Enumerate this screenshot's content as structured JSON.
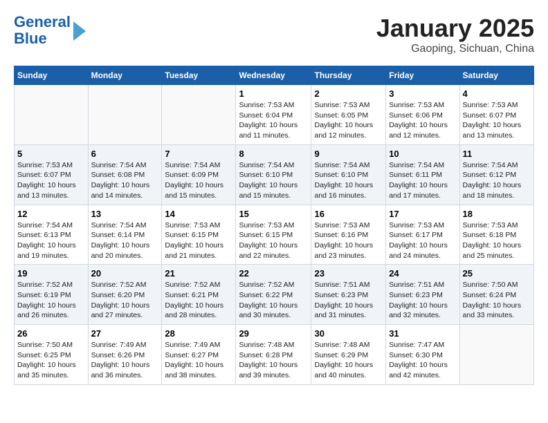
{
  "header": {
    "logo_line1": "General",
    "logo_line2": "Blue",
    "month": "January 2025",
    "location": "Gaoping, Sichuan, China"
  },
  "days_of_week": [
    "Sunday",
    "Monday",
    "Tuesday",
    "Wednesday",
    "Thursday",
    "Friday",
    "Saturday"
  ],
  "weeks": [
    [
      {
        "day": "",
        "content": ""
      },
      {
        "day": "",
        "content": ""
      },
      {
        "day": "",
        "content": ""
      },
      {
        "day": "1",
        "content": "Sunrise: 7:53 AM\nSunset: 6:04 PM\nDaylight: 10 hours and 11 minutes."
      },
      {
        "day": "2",
        "content": "Sunrise: 7:53 AM\nSunset: 6:05 PM\nDaylight: 10 hours and 12 minutes."
      },
      {
        "day": "3",
        "content": "Sunrise: 7:53 AM\nSunset: 6:06 PM\nDaylight: 10 hours and 12 minutes."
      },
      {
        "day": "4",
        "content": "Sunrise: 7:53 AM\nSunset: 6:07 PM\nDaylight: 10 hours and 13 minutes."
      }
    ],
    [
      {
        "day": "5",
        "content": "Sunrise: 7:53 AM\nSunset: 6:07 PM\nDaylight: 10 hours and 13 minutes."
      },
      {
        "day": "6",
        "content": "Sunrise: 7:54 AM\nSunset: 6:08 PM\nDaylight: 10 hours and 14 minutes."
      },
      {
        "day": "7",
        "content": "Sunrise: 7:54 AM\nSunset: 6:09 PM\nDaylight: 10 hours and 15 minutes."
      },
      {
        "day": "8",
        "content": "Sunrise: 7:54 AM\nSunset: 6:10 PM\nDaylight: 10 hours and 15 minutes."
      },
      {
        "day": "9",
        "content": "Sunrise: 7:54 AM\nSunset: 6:10 PM\nDaylight: 10 hours and 16 minutes."
      },
      {
        "day": "10",
        "content": "Sunrise: 7:54 AM\nSunset: 6:11 PM\nDaylight: 10 hours and 17 minutes."
      },
      {
        "day": "11",
        "content": "Sunrise: 7:54 AM\nSunset: 6:12 PM\nDaylight: 10 hours and 18 minutes."
      }
    ],
    [
      {
        "day": "12",
        "content": "Sunrise: 7:54 AM\nSunset: 6:13 PM\nDaylight: 10 hours and 19 minutes."
      },
      {
        "day": "13",
        "content": "Sunrise: 7:54 AM\nSunset: 6:14 PM\nDaylight: 10 hours and 20 minutes."
      },
      {
        "day": "14",
        "content": "Sunrise: 7:53 AM\nSunset: 6:15 PM\nDaylight: 10 hours and 21 minutes."
      },
      {
        "day": "15",
        "content": "Sunrise: 7:53 AM\nSunset: 6:15 PM\nDaylight: 10 hours and 22 minutes."
      },
      {
        "day": "16",
        "content": "Sunrise: 7:53 AM\nSunset: 6:16 PM\nDaylight: 10 hours and 23 minutes."
      },
      {
        "day": "17",
        "content": "Sunrise: 7:53 AM\nSunset: 6:17 PM\nDaylight: 10 hours and 24 minutes."
      },
      {
        "day": "18",
        "content": "Sunrise: 7:53 AM\nSunset: 6:18 PM\nDaylight: 10 hours and 25 minutes."
      }
    ],
    [
      {
        "day": "19",
        "content": "Sunrise: 7:52 AM\nSunset: 6:19 PM\nDaylight: 10 hours and 26 minutes."
      },
      {
        "day": "20",
        "content": "Sunrise: 7:52 AM\nSunset: 6:20 PM\nDaylight: 10 hours and 27 minutes."
      },
      {
        "day": "21",
        "content": "Sunrise: 7:52 AM\nSunset: 6:21 PM\nDaylight: 10 hours and 28 minutes."
      },
      {
        "day": "22",
        "content": "Sunrise: 7:52 AM\nSunset: 6:22 PM\nDaylight: 10 hours and 30 minutes."
      },
      {
        "day": "23",
        "content": "Sunrise: 7:51 AM\nSunset: 6:23 PM\nDaylight: 10 hours and 31 minutes."
      },
      {
        "day": "24",
        "content": "Sunrise: 7:51 AM\nSunset: 6:23 PM\nDaylight: 10 hours and 32 minutes."
      },
      {
        "day": "25",
        "content": "Sunrise: 7:50 AM\nSunset: 6:24 PM\nDaylight: 10 hours and 33 minutes."
      }
    ],
    [
      {
        "day": "26",
        "content": "Sunrise: 7:50 AM\nSunset: 6:25 PM\nDaylight: 10 hours and 35 minutes."
      },
      {
        "day": "27",
        "content": "Sunrise: 7:49 AM\nSunset: 6:26 PM\nDaylight: 10 hours and 36 minutes."
      },
      {
        "day": "28",
        "content": "Sunrise: 7:49 AM\nSunset: 6:27 PM\nDaylight: 10 hours and 38 minutes."
      },
      {
        "day": "29",
        "content": "Sunrise: 7:48 AM\nSunset: 6:28 PM\nDaylight: 10 hours and 39 minutes."
      },
      {
        "day": "30",
        "content": "Sunrise: 7:48 AM\nSunset: 6:29 PM\nDaylight: 10 hours and 40 minutes."
      },
      {
        "day": "31",
        "content": "Sunrise: 7:47 AM\nSunset: 6:30 PM\nDaylight: 10 hours and 42 minutes."
      },
      {
        "day": "",
        "content": ""
      }
    ]
  ]
}
